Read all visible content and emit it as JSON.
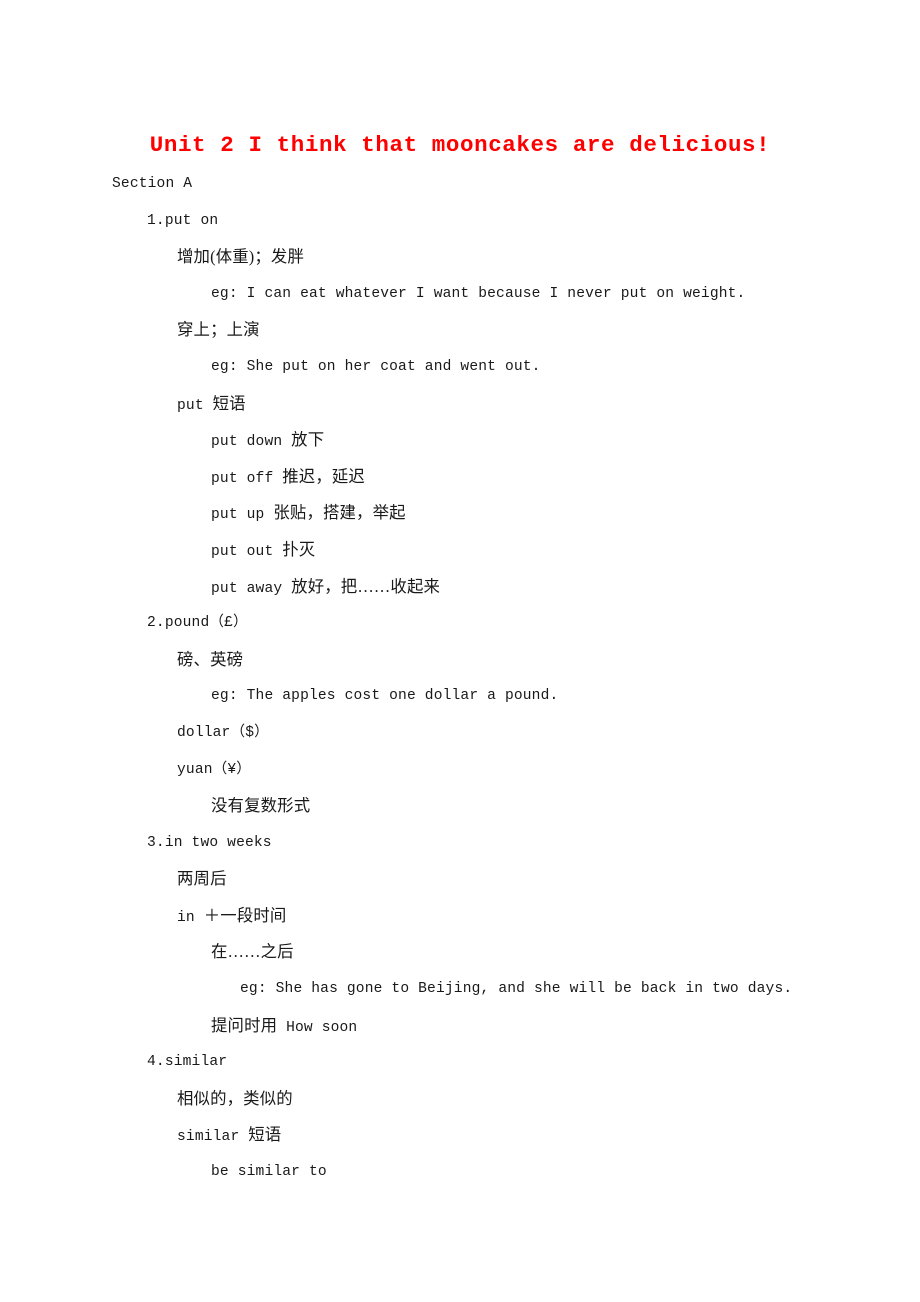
{
  "document": {
    "title": "Unit 2 I think that mooncakes are delicious!",
    "title_color": "#ff0000",
    "section_label": "Section A"
  },
  "entries": [
    {
      "number": "1.put on",
      "lines": [
        {
          "text": "增加(体重)；发胖",
          "indent": 2,
          "style": "cjk"
        },
        {
          "text": "eg: I can eat whatever I want because I never put on weight.",
          "indent": 3,
          "style": "latin"
        },
        {
          "text": "穿上；上演",
          "indent": 2,
          "style": "cjk"
        },
        {
          "text": "eg: She put on her coat and went out.",
          "indent": 3,
          "style": "latin"
        },
        {
          "text": "put 短语",
          "indent": 2,
          "style": "mix"
        },
        {
          "text": "put down 放下",
          "indent": 3,
          "style": "mix"
        },
        {
          "text": "put off 推迟，延迟",
          "indent": 3,
          "style": "mix"
        },
        {
          "text": "put up 张贴，搭建，举起",
          "indent": 3,
          "style": "mix"
        },
        {
          "text": "put out 扑灭",
          "indent": 3,
          "style": "mix"
        },
        {
          "text": "put away 放好，把……收起来",
          "indent": 3,
          "style": "mix"
        }
      ]
    },
    {
      "number": "2.pound（£）",
      "lines": [
        {
          "text": "磅、英磅",
          "indent": 2,
          "style": "cjk"
        },
        {
          "text": "eg: The apples cost one dollar a pound.",
          "indent": 3,
          "style": "latin"
        },
        {
          "text": "dollar（$）",
          "indent": 2,
          "style": "latin"
        },
        {
          "text": "yuan（¥）",
          "indent": 2,
          "style": "latin"
        },
        {
          "text": "没有复数形式",
          "indent": 3,
          "style": "cjk"
        }
      ]
    },
    {
      "number": "3.in two weeks",
      "lines": [
        {
          "text": "两周后",
          "indent": 2,
          "style": "cjk"
        },
        {
          "text": "in ＋一段时间",
          "indent": 2,
          "style": "mix"
        },
        {
          "text": "在……之后",
          "indent": 3,
          "style": "cjk"
        },
        {
          "text": "eg: She has gone to Beijing, and she will be back in two days.",
          "indent": 4,
          "style": "latin"
        },
        {
          "text": "提问时用 How soon",
          "indent": 3,
          "style": "mix"
        }
      ]
    },
    {
      "number": "4.similar",
      "lines": [
        {
          "text": "相似的，类似的",
          "indent": 2,
          "style": "cjk"
        },
        {
          "text": "similar 短语",
          "indent": 2,
          "style": "mix"
        },
        {
          "text": "be similar to",
          "indent": 3,
          "style": "latin"
        }
      ]
    }
  ]
}
